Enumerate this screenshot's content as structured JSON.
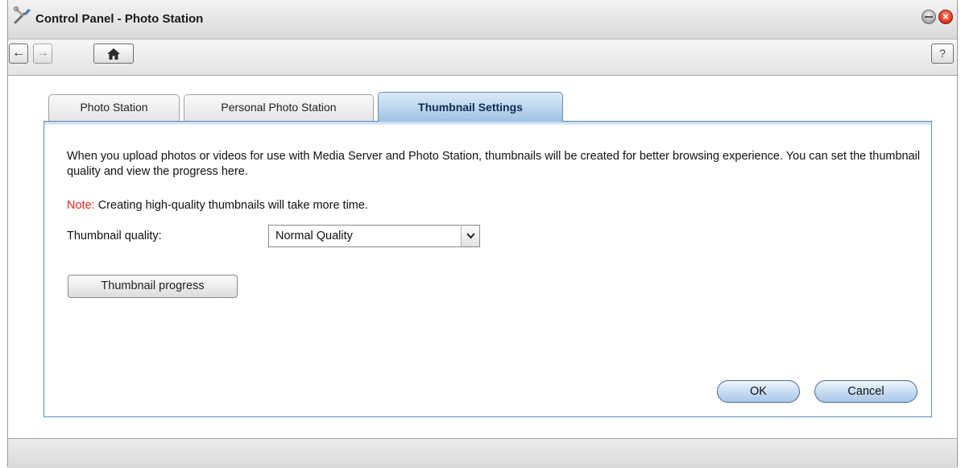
{
  "window": {
    "title": "Control Panel - Photo Station",
    "minimize_icon": "minimize-icon",
    "close_icon": "close-icon"
  },
  "toolbar": {
    "back_icon": "arrow-left-icon",
    "back_glyph": "←",
    "forward_icon": "arrow-right-icon",
    "forward_glyph": "→",
    "home_icon": "home-icon",
    "home_glyph": "⌂",
    "help_icon": "help-icon",
    "help_label": "?"
  },
  "tabs": [
    {
      "label": "Photo Station",
      "active": false
    },
    {
      "label": "Personal Photo Station",
      "active": false
    },
    {
      "label": "Thumbnail Settings",
      "active": true
    }
  ],
  "panel": {
    "description": "When you upload photos or videos for use with Media Server and Photo Station, thumbnails will be created for better browsing experience. You can set the thumbnail quality and view the progress here.",
    "note_label": "Note:",
    "note_text": " Creating high-quality thumbnails will take more time.",
    "quality_label": "Thumbnail quality:",
    "quality_value": "Normal Quality",
    "progress_button": "Thumbnail progress",
    "ok_button": "OK",
    "cancel_button": "Cancel"
  },
  "colors": {
    "note_red": "#e0261c",
    "active_tab_blue": "#9fc2e4",
    "panel_border": "#5f8dbb"
  }
}
